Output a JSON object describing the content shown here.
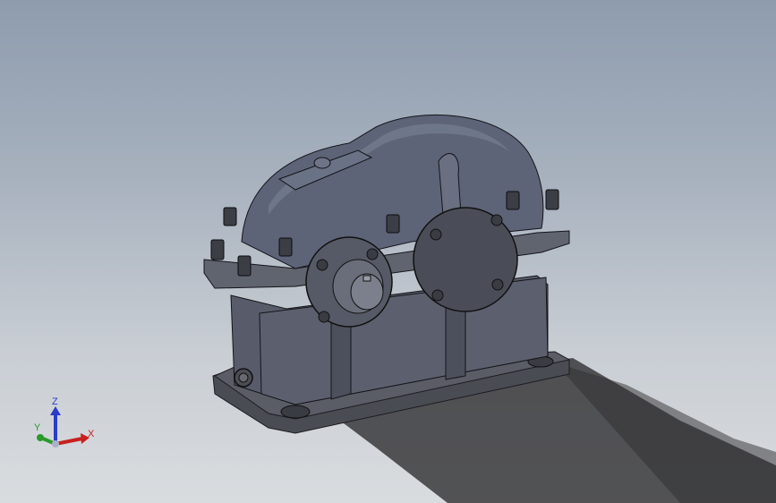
{
  "viewport": {
    "background_top": "#8e9cae",
    "background_bottom": "#d9dcdf"
  },
  "model": {
    "name": "gear-reducer-assembly",
    "housing_color": "#585c6a",
    "base_color": "#4e5058",
    "cover_color": "#5d6478"
  },
  "triad": {
    "x_label": "X",
    "y_label": "Y",
    "z_label": "Z",
    "x_color": "#c82020",
    "y_color": "#2a9a2a",
    "z_color": "#2a3cc8"
  }
}
